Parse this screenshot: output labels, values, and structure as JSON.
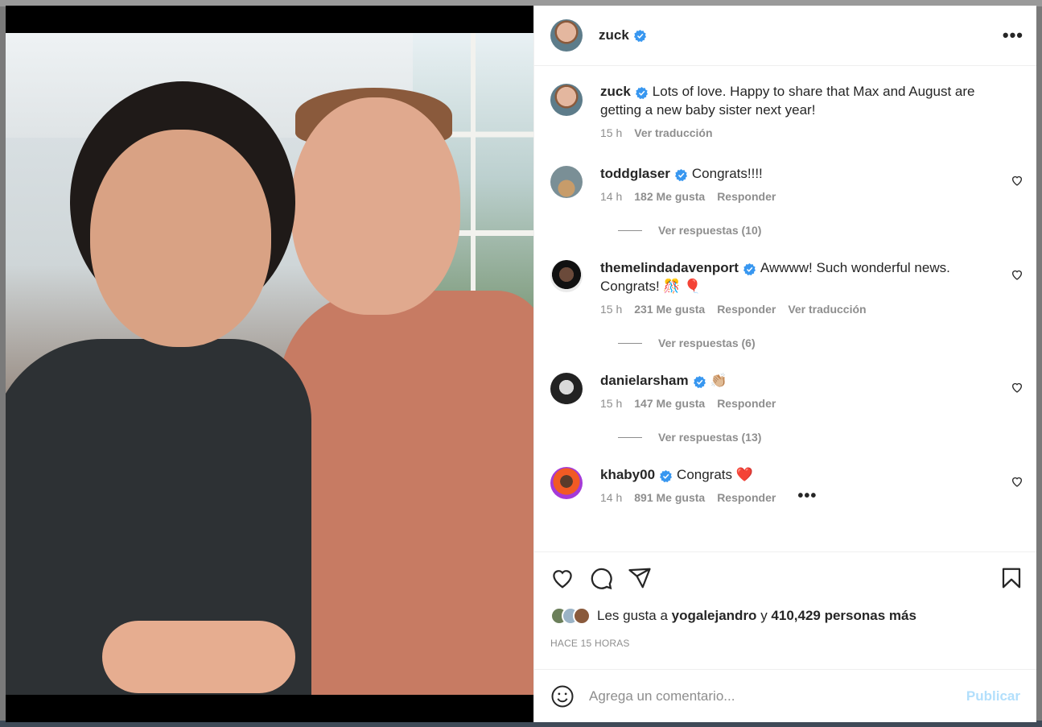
{
  "post": {
    "author": "zuck",
    "more_label": "•••",
    "caption": {
      "user": "zuck",
      "text": "Lots of love. Happy to share that Max and August are getting a new baby sister next year!",
      "time": "15 h",
      "translate": "Ver traducción"
    }
  },
  "comments": [
    {
      "user": "toddglaser",
      "text": "Congrats!!!!",
      "time": "14 h",
      "likes": "182 Me gusta",
      "reply": "Responder",
      "replies": "Ver respuestas (10)",
      "avatar": "todd-avatar"
    },
    {
      "user": "themelindadavenport",
      "text": "Awwww! Such wonderful news. Congrats! 🎊 🎈",
      "time": "15 h",
      "likes": "231 Me gusta",
      "reply": "Responder",
      "translate": "Ver traducción",
      "replies": "Ver respuestas (6)",
      "avatar": "melinda-avatar"
    },
    {
      "user": "danielarsham",
      "text": "👏🏼",
      "time": "15 h",
      "likes": "147 Me gusta",
      "reply": "Responder",
      "replies": "Ver respuestas (13)",
      "avatar": "daniel-avatar"
    },
    {
      "user": "khaby00",
      "text": "Congrats ❤️",
      "time": "14 h",
      "likes": "891 Me gusta",
      "reply": "Responder",
      "more": "•••",
      "avatar": "khaby-avatar"
    }
  ],
  "actions": {
    "icons": [
      "heart-icon",
      "comment-icon",
      "share-icon",
      "bookmark-icon"
    ],
    "likes_prefix": "Les gusta a",
    "likes_user": "yogalejandro",
    "likes_connector": "y",
    "likes_others": "410,429 personas más",
    "timestamp": "HACE 15 HORAS"
  },
  "composer": {
    "placeholder": "Agrega un comentario...",
    "publish_label": "Publicar"
  },
  "colors": {
    "verified": "#3897f0",
    "publish": "#b2dffc",
    "muted": "#8e8e8e"
  }
}
